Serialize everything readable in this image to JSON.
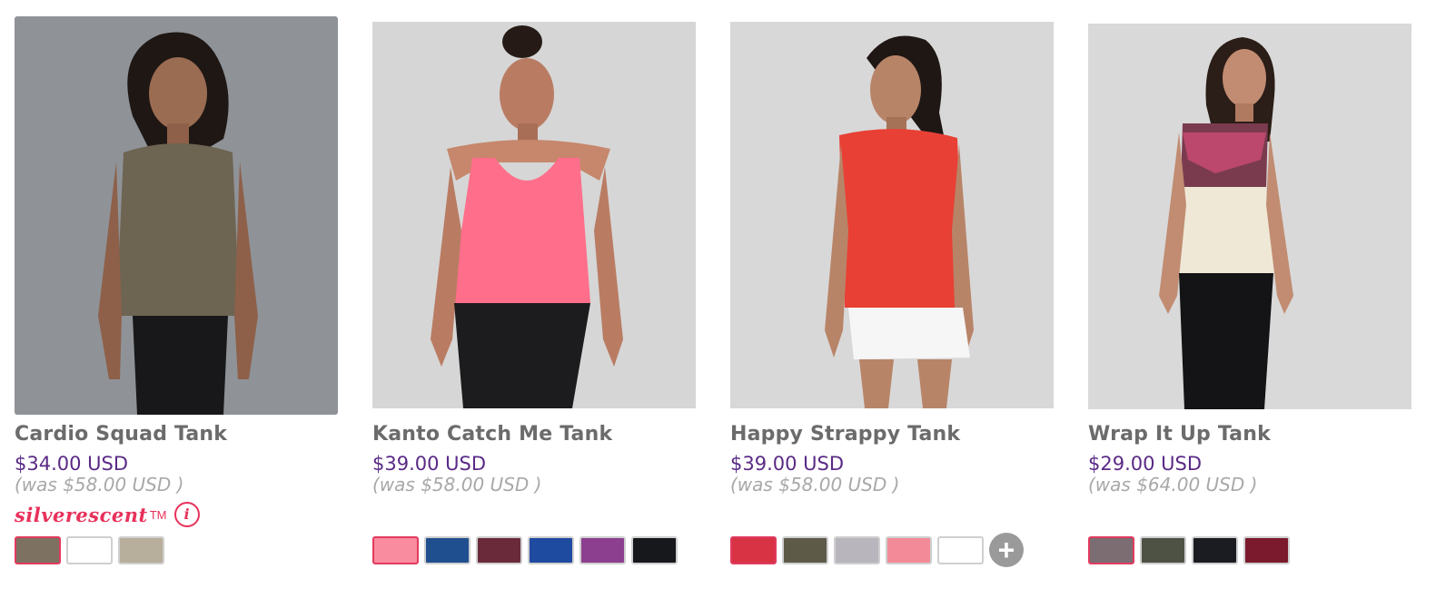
{
  "products": [
    {
      "name": "Cardio Squad Tank",
      "price": "$34.00 USD",
      "was_price": "(was $58.00 USD )",
      "technology_label": "silverescent",
      "trademark": "TM",
      "info_icon": "i",
      "photo_background": "#8f9398",
      "garment_color": "#6e6452",
      "swatch_colors": [
        "#7d7262",
        "#ffffff",
        "#b8ae9c"
      ],
      "selected_swatch": 0
    },
    {
      "name": "Kanto Catch Me Tank",
      "price": "$39.00 USD",
      "was_price": "(was $58.00 USD )",
      "photo_background": "#d6d6d6",
      "garment_color": "#ff6e8a",
      "swatch_colors": [
        "#f98c9e",
        "#1f4f8f",
        "#6a2a3a",
        "#1e4aa0",
        "#8c3f8e",
        "#17181c"
      ],
      "selected_swatch": 0
    },
    {
      "name": "Happy Strappy Tank",
      "price": "$39.00 USD",
      "was_price": "(was $58.00 USD )",
      "photo_background": "#d8d8d8",
      "garment_color": "#e84035",
      "swatch_colors": [
        "#d73345",
        "#5e5a48",
        "#b9b5bd",
        "#f28b97",
        "#ffffff"
      ],
      "selected_swatch": 0,
      "more_icon": "+"
    },
    {
      "name": "Wrap It Up Tank",
      "price": "$29.00 USD",
      "was_price": "(was $64.00 USD )",
      "photo_background": "#d9d9d9",
      "garment_color": "#efe8d6",
      "swatch_colors": [
        "#7c6d73",
        "#4d5245",
        "#1a1c22",
        "#7a1a2c"
      ],
      "selected_swatch": 0
    }
  ]
}
